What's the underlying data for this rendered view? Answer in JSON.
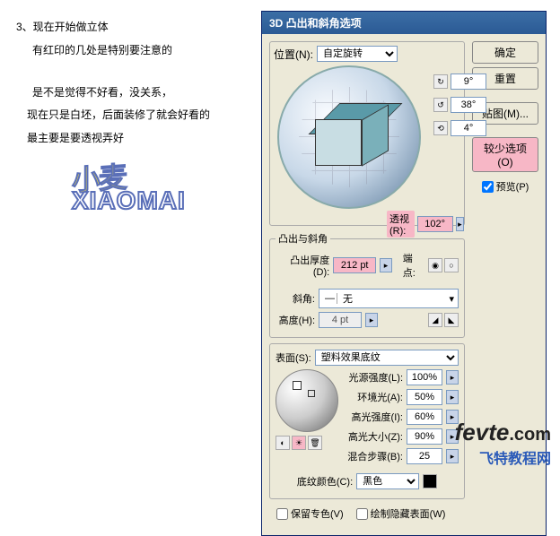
{
  "instructions": {
    "l1": "3、现在开始做立体",
    "l2": "有红印的几处是特别要注意的",
    "l3": "是不是觉得不好看，没关系，",
    "l4": "现在只是白坯，后面装修了就会好看的",
    "l5": "最主要是要透视弄好"
  },
  "art": {
    "cn": "小麦",
    "en": "XIAOMAI"
  },
  "dialog": {
    "title": "3D 凸出和斜角选项",
    "position": {
      "label": "位置(N):",
      "value": "自定旋转"
    },
    "angles": {
      "x": "9°",
      "y": "38°",
      "z": "4°"
    },
    "perspective": {
      "label": "透视(R):",
      "value": "102°"
    },
    "extrude": {
      "legend": "凸出与斜角",
      "depth_label": "凸出厚度(D):",
      "depth_value": "212 pt",
      "cap_label": "端点:",
      "bevel_label": "斜角:",
      "bevel_value": "无",
      "height_label": "高度(H):",
      "height_value": "4 pt"
    },
    "surface": {
      "label": "表面(S):",
      "value": "塑料效果底纹",
      "light_intensity_label": "光源强度(L):",
      "light_intensity": "100%",
      "ambient_label": "环境光(A):",
      "ambient": "50%",
      "highlight_intensity_label": "高光强度(I):",
      "highlight_intensity": "60%",
      "highlight_size_label": "高光大小(Z):",
      "highlight_size": "90%",
      "blend_label": "混合步骤(B):",
      "blend": "25",
      "shade_label": "底纹颜色(C):",
      "shade_value": "黑色"
    },
    "buttons": {
      "ok": "确定",
      "cancel": "重置",
      "map": "贴图(M)...",
      "less": "较少选项(O)",
      "preview": "预览(P)"
    },
    "footer": {
      "preserve": "保留专色(V)",
      "hidden": "绘制隐藏表面(W)"
    }
  },
  "logo": {
    "big": "fevte",
    "com": ".com",
    "sub": "飞特教程网"
  }
}
